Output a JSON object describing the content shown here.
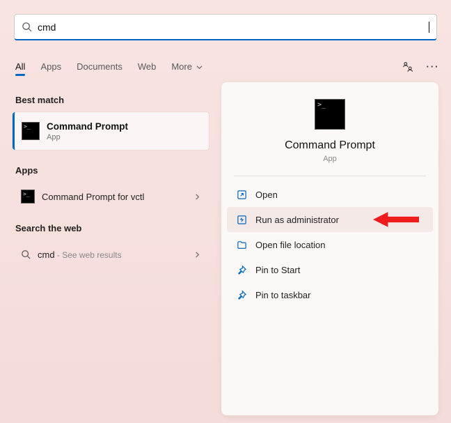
{
  "search": {
    "query": "cmd"
  },
  "tabs": {
    "all": "All",
    "apps": "Apps",
    "documents": "Documents",
    "web": "Web",
    "more": "More"
  },
  "sections": {
    "best_match": "Best match",
    "apps": "Apps",
    "search_web": "Search the web"
  },
  "best": {
    "title": "Command Prompt",
    "subtitle": "App"
  },
  "apps_list": {
    "item0": "Command Prompt for vctl"
  },
  "web_list": {
    "item0_term": "cmd",
    "item0_suffix": " - See web results"
  },
  "detail": {
    "title": "Command Prompt",
    "subtitle": "App",
    "actions": {
      "open": "Open",
      "run_admin": "Run as administrator",
      "open_loc": "Open file location",
      "pin_start": "Pin to Start",
      "pin_taskbar": "Pin to taskbar"
    }
  }
}
